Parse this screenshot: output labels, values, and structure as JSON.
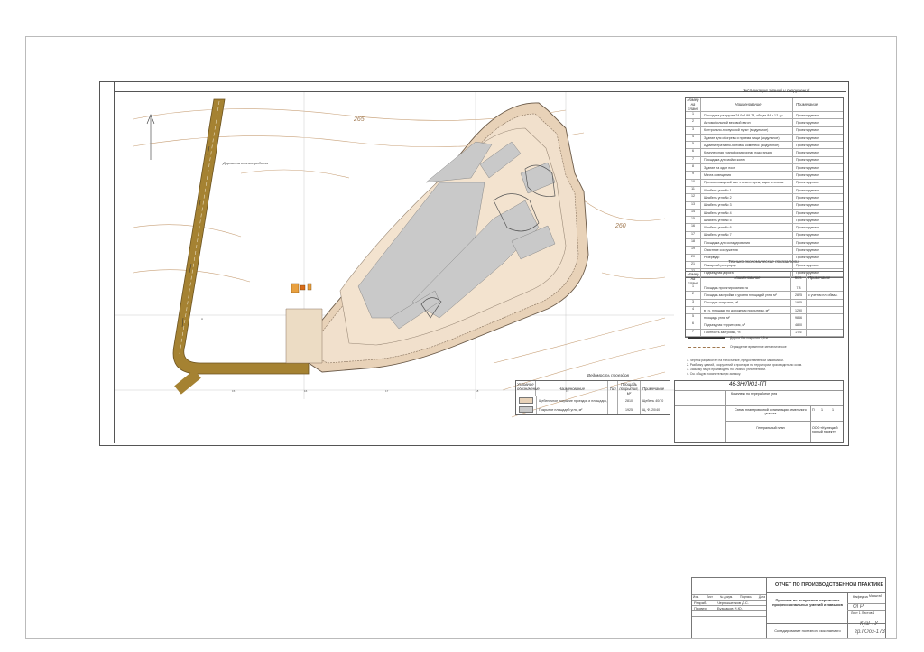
{
  "drawing": {
    "contour_265": "265",
    "contour_260": "260",
    "road_label": "Дорога на горные работы"
  },
  "buildings_table": {
    "caption": "Экспликация зданий и сооружений",
    "headers": [
      "Номер на плане",
      "Наименование",
      "Примечание"
    ],
    "rows": [
      [
        "1",
        "Площадка разгрузки 24.0x4.99-78, общая 84 x 1'1 ур.",
        "Проектируемое"
      ],
      [
        "2",
        "Автомобильный весовой вагон",
        "Проектируемое"
      ],
      [
        "3",
        "Контрольно-пропускной пункт (модульное)",
        "Проектируемое"
      ],
      [
        "4",
        "Здание для обогрева и приема пищи (модульное)",
        "Проектируемое"
      ],
      [
        "5",
        "Административно-бытовой комплекс (модульное)",
        "Проектируемое"
      ],
      [
        "6",
        "Комплексная трансформаторная подстанция",
        "Проектируемое"
      ],
      [
        "7",
        "Площадка для мойки колес",
        "Проектируемое"
      ],
      [
        "8",
        "Здание на один пост",
        "Проектируемое"
      ],
      [
        "9",
        "Мачта освещения",
        "Проектируемое"
      ],
      [
        "10",
        "Противопожарный щит с инвентарем, ящик с песком",
        "Проектируемое"
      ],
      [
        "11",
        "Штабель угля № 1",
        "Проектируемое"
      ],
      [
        "12",
        "Штабель угля № 2",
        "Проектируемое"
      ],
      [
        "13",
        "Штабель угля № 3",
        "Проектируемое"
      ],
      [
        "14",
        "Штабель угля № 4",
        "Проектируемое"
      ],
      [
        "15",
        "Штабель угля № 5",
        "Проектируемое"
      ],
      [
        "16",
        "Штабель угля № 6",
        "Проектируемое"
      ],
      [
        "17",
        "Штабель угля № 7",
        "Проектируемое"
      ],
      [
        "18",
        "Площадка для складирования",
        "Проектируемое"
      ],
      [
        "19",
        "Очистные сооружения",
        "Проектируемое"
      ],
      [
        "20",
        "Резервуар",
        "Проектируемое"
      ],
      [
        "21",
        "Пожарный резервуар",
        "Проектируемое"
      ],
      [
        "22",
        "Подъездная дорога",
        "Проектируемое"
      ]
    ]
  },
  "tech_table": {
    "caption": "Технико-экономические показатели",
    "headers": [
      "Номер на плане",
      "Наименование",
      "Кол.",
      "Примечание"
    ],
    "rows": [
      [
        "1",
        "Площадь проектирования, га",
        "7.8",
        ""
      ],
      [
        "2",
        "Площадь застройки и уровня площадей угля, м²",
        "2825",
        "с учетом пл. обвал."
      ],
      [
        "3",
        "Площадь покрытия, м²",
        "1925",
        ""
      ],
      [
        "4",
        "в т.ч. площадь по дорожным покрытиям, м²",
        "1290",
        ""
      ],
      [
        "5",
        "площадь угля, м²",
        "9866",
        ""
      ],
      [
        "6",
        "Подъездная территория, м²",
        "4800",
        ""
      ],
      [
        "7",
        "Плотность застройки, %",
        "27.6",
        ""
      ]
    ]
  },
  "legend": {
    "item1": "Дорога без покрытия 7,5 м",
    "item2": "Ограждение временное металлическое"
  },
  "notes": {
    "n1": "1. Чертеж разработан на топосъемке, предоставленной заказчиком.",
    "n2": "2. Разбивку зданий, сооружений и проездов на территории производить по осям.",
    "n3": "3. Засыпку пазух производить по слоям с уплотнением.",
    "n4": "4. См. общую пояснительную записку."
  },
  "roads_table": {
    "caption": "Ведомость проездов",
    "headers": [
      "Условное обозначение",
      "Наименование",
      "Тип",
      "Площадь покрытия, м²",
      "Примечание"
    ],
    "rows": [
      [
        "",
        "Щебеночное покрытие проездов и площадок, м²",
        "",
        "2810",
        "Щебень 40/70"
      ],
      [
        "",
        "Покрытие площадей угля, м²",
        "",
        "1925",
        "Щ. Ф. 20/40"
      ]
    ]
  },
  "inner_stamp": {
    "code": "46-3Н/ЛЮ1-ГП",
    "desc": "Комплекс по переработке угля",
    "title": "Схема планировочной организации земельного участка",
    "sheet_title": "Генеральный план",
    "org": "ООО «Кузнецкий горный проект»",
    "stage": "П",
    "sheet": "1",
    "sheets": "1"
  },
  "main_stamp": {
    "top_title": "ОТЧЕТ ПО ПРОИЗВОДСТВЕННОЙ ПРАКТИКЕ",
    "cols": [
      "Изм.",
      "Лист",
      "№ докум.",
      "Подпись",
      "Дата"
    ],
    "role1": "Разраб.",
    "name1": "Чернышенков Д.С.",
    "role2": "Провер.",
    "name2": "Бузмаков И.Ю.",
    "work_title": "Практика по получению первичных профессиональных умений и навыков",
    "subject": "Складирование полезного ископаемого",
    "dept_label": "Кафедра",
    "dept": "Масштаб",
    "dept_value": "ОГР",
    "sheet_text": "Лист 1   Листов 1",
    "uni": "КузГТУ",
    "group": "гр.ГОоз-173"
  }
}
